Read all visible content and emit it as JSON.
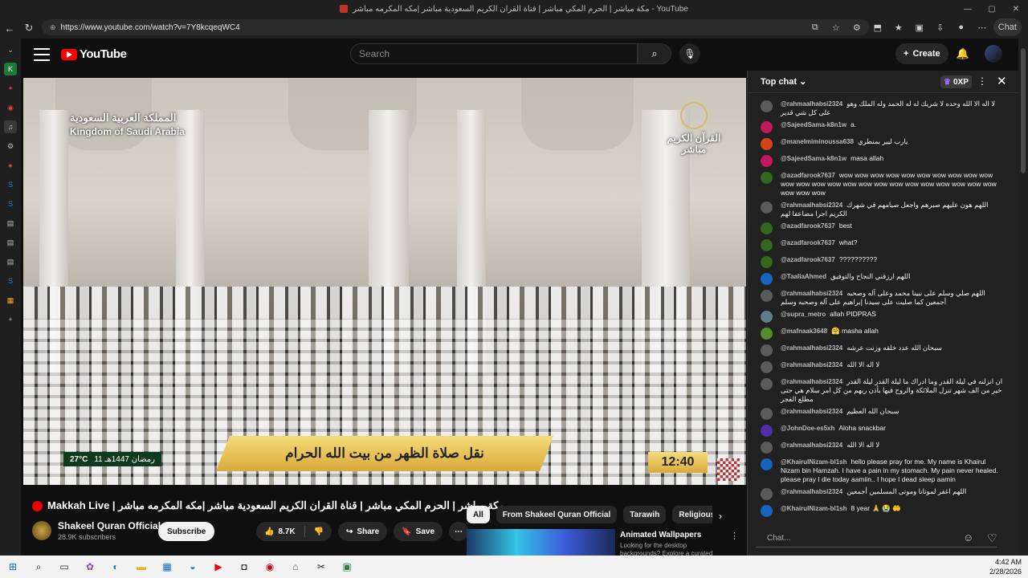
{
  "browser": {
    "window_title": "مكة مباشر | الحرم المكي مباشر | قناة القران الكريم السعودية مباشر |مكه المكرمه مباشر - YouTube",
    "url": "https://www.youtube.com/watch?v=7Y8kcqeqWC4",
    "chat_button": "Chat"
  },
  "youtube": {
    "logo_text": "YouTube",
    "search_placeholder": "Search",
    "create_label": "Create"
  },
  "video": {
    "overlay_arabic": "المملكة العربية السعودية",
    "overlay_english": "Kingdom of Saudi Arabia",
    "channel_logo_line1": "القرآن الكريم",
    "channel_logo_line2": "مباشر",
    "banner": "نقل صلاة الظهر من بيت الله الحرام",
    "temperature": "27°C",
    "hijri_date": "11 رمضان 1447هـ",
    "clock": "12:40"
  },
  "meta": {
    "title": "Makkah Live | مكة مباشر | الحرم المكي مباشر | قناة القران الكريم السعودية مباشر |مكه المكرمه مباشر",
    "channel_name": "Shakeel Quran Official",
    "subscribers": "28.9K subscribers",
    "subscribe_label": "Subscribe",
    "likes": "8.7K",
    "share_label": "Share",
    "save_label": "Save"
  },
  "chips": [
    "All",
    "From Shakeel Quran Official",
    "Tarawih",
    "Religious recitat"
  ],
  "recommendation": {
    "title": "Animated Wallpapers",
    "description": "Looking for the desktop backgrounds? Explore a curated"
  },
  "chat": {
    "header": "Top chat",
    "xp": "0XP",
    "input_placeholder": "Chat...",
    "messages": [
      {
        "author": "@rahmaalhabsi2324",
        "text": "لا اله الا الله وحده لا شريك له له الحمد وله الملك وهو على كل شي قدير",
        "color": "#5b5b5b"
      },
      {
        "author": "@SajeedSama-k8n1w",
        "text": "a.",
        "color": "#c2185b"
      },
      {
        "author": "@manelmiminoussa638",
        "text": "يارب ليير بمنطري",
        "color": "#d84315"
      },
      {
        "author": "@SajeedSama-k8n1w",
        "text": "masa allah",
        "color": "#c2185b"
      },
      {
        "author": "@azadfarook7637",
        "text": "wow wow wow wow wow wow wow wow wow wow wow wow wow wow wow wow wow wow wow wow wow wow wow wow wow wow wow",
        "color": "#33691e"
      },
      {
        "author": "@rahmaalhabsi2324",
        "text": "اللهم هون عليهم صبرهم واجعل صيامهم في شهرك الكريم اجرا مضاعفا لهم",
        "color": "#5b5b5b"
      },
      {
        "author": "@azadfarook7637",
        "text": "best",
        "color": "#33691e"
      },
      {
        "author": "@azadfarook7637",
        "text": "what?",
        "color": "#33691e"
      },
      {
        "author": "@azadfarook7637",
        "text": "??????????",
        "color": "#33691e"
      },
      {
        "author": "@TaaliaAhmed",
        "text": "اللهم ارزقني النجاح والتوفيق",
        "color": "#1565c0"
      },
      {
        "author": "@rahmaalhabsi2324",
        "text": "اللهم صلي وسلم على نبينا محمد وعلى آله وصحبه أجمعين كما صليت على سيدنا إبراهيم على آله وصحبه وسلم",
        "color": "#5b5b5b"
      },
      {
        "author": "@supra_metro",
        "text": "allah PIDPRAS",
        "color": "#607d8b"
      },
      {
        "author": "@mafnaak3648",
        "text": "🤗 masha allah",
        "color": "#558b2f"
      },
      {
        "author": "@rahmaalhabsi2324",
        "text": "سبحان الله عدد خلقه وزنت عرشه",
        "color": "#5b5b5b"
      },
      {
        "author": "@rahmaalhabsi2324",
        "text": "لا اله الا الله",
        "color": "#5b5b5b"
      },
      {
        "author": "@rahmaalhabsi2324",
        "text": "ان انزلنه في ليلة القدر وما ادراك ما ليلة القدر ليلة القدر خير من الف شهر تنزل الملائكة والروح فيها بأذن ربهم من كل امر سلام هي حتى مطلع الفجر",
        "color": "#5b5b5b"
      },
      {
        "author": "@rahmaalhabsi2324",
        "text": "سبحان الله العظيم",
        "color": "#5b5b5b"
      },
      {
        "author": "@JohnDoe-es5xh",
        "text": "Aloha snackbar",
        "color": "#512da8"
      },
      {
        "author": "@rahmaalhabsi2324",
        "text": "لا اله الا الله",
        "color": "#5b5b5b"
      },
      {
        "author": "@KhairulNizam-bl1sh",
        "text": "hello please pray for me. My name is Khairul Nizam bin Hamzah. I have a pain in my stomach. My pain never healed. please pray I die today aamiin.. I hope I dead sleep aamin",
        "color": "#1565c0"
      },
      {
        "author": "@rahmaalhabsi2324",
        "text": "اللهم اغفر لموتانا وموتى المسلمين أجمعين",
        "color": "#5b5b5b"
      },
      {
        "author": "@KhairulNizam-bl1sh",
        "text": "8 year 🙏 😭 🤲",
        "color": "#1565c0"
      }
    ]
  },
  "taskbar": {
    "time": "4:42 AM",
    "date": "2/28/2026"
  }
}
